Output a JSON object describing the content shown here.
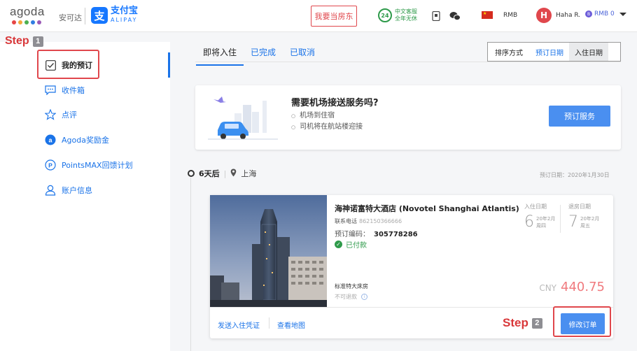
{
  "header": {
    "logo_text": "agoda",
    "logo_dot_colors": [
      "#e64545",
      "#f2a93b",
      "#4cb050",
      "#2f7de1",
      "#9b59b6"
    ],
    "partner_label": "安可达",
    "alipay_cn": "支付宝",
    "alipay_en": "ALIPAY",
    "host_button": "我要当房东",
    "support_badge": "24",
    "support_line1": "中文客服",
    "support_line2": "全年无休",
    "currency": "RMB",
    "avatar_initial": "H",
    "username": "Haha R.",
    "points": "RMB 0"
  },
  "sidebar": {
    "items": [
      {
        "label": "我的预订",
        "icon": "checkbox-icon"
      },
      {
        "label": "收件箱",
        "icon": "chat-icon"
      },
      {
        "label": "点评",
        "icon": "star-icon"
      },
      {
        "label": "Agoda奖励金",
        "icon": "coin-icon"
      },
      {
        "label": "PointsMAX回馈计划",
        "icon": "points-icon"
      },
      {
        "label": "账户信息",
        "icon": "user-icon"
      }
    ]
  },
  "annotations": {
    "step1_text": "Step",
    "step1_num": "1",
    "step2_text": "Step",
    "step2_num": "2",
    "highlight_color": "#e0474c"
  },
  "tabs": [
    "即将入住",
    "已完成",
    "已取消"
  ],
  "sort": {
    "label": "排序方式",
    "options": [
      "预订日期",
      "入住日期"
    ],
    "selected": "入住日期"
  },
  "promo": {
    "title": "需要机场接送服务吗?",
    "bullets": [
      "机场到住宿",
      "司机将在航站楼迎接"
    ],
    "button": "预订服务"
  },
  "timeline": {
    "days": "6天后",
    "city": "上海",
    "booking_date": "预订日期：2020年1月30日"
  },
  "booking": {
    "hotel_name": "海神诺富特大酒店 (Novotel Shanghai Atlantis)",
    "contact_label": "联系电话",
    "contact_number": "862150366666",
    "booking_no_label": "预订编码：",
    "booking_no": "305778286",
    "status": "已付款",
    "checkin_label": "入住日期",
    "checkin_day": "6",
    "checkin_month": "20年2月",
    "checkin_weekday": "周四",
    "checkout_label": "退房日期",
    "checkout_day": "7",
    "checkout_month": "20年2月",
    "checkout_weekday": "周五",
    "room_type": "标准特大床房",
    "refund_policy": "不可退款",
    "price_currency": "CNY",
    "price_value": "440.75",
    "link_voucher": "发送入住凭证",
    "link_map": "查看地图",
    "modify_button": "修改订单"
  },
  "colors": {
    "accent": "#1a73e8",
    "button_blue": "#4a8ff0",
    "brand_red": "#e0474c",
    "paid_green": "#2e9a4a"
  }
}
